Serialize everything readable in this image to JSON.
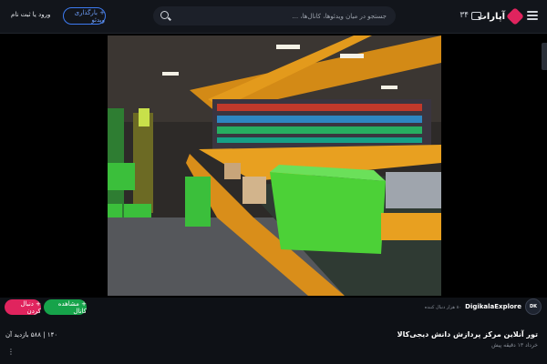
{
  "header": {
    "logo_text": "آپارات",
    "notifications_count": "۳۴",
    "search_placeholder": "جستجو در میان ویدئوها، کانال‌ها، ...",
    "upload_label": "+ بارگذاری ویدئو",
    "login_label": "ورود یا ثبت نام"
  },
  "video": {
    "title": "تور آنلاین مرکز پردازش دانش دیجی‌کالا",
    "meta": "خرداد ۱۳ دقیقه پیش",
    "stats": "۱۴۰ | ۵۸۸ بازدید",
    "stats_suffix": "آن"
  },
  "channel": {
    "name": "DigikalaExplore",
    "avatar_text": "DK",
    "followers": "۸۰ هزار دنبال کننده"
  },
  "actions": {
    "follow_label": "+ دنبال کردن",
    "download_label": "+ مشاهده کانال"
  },
  "colors": {
    "accent_red": "#e0245e",
    "accent_green": "#16a34a",
    "accent_blue": "#3d7bf2"
  }
}
